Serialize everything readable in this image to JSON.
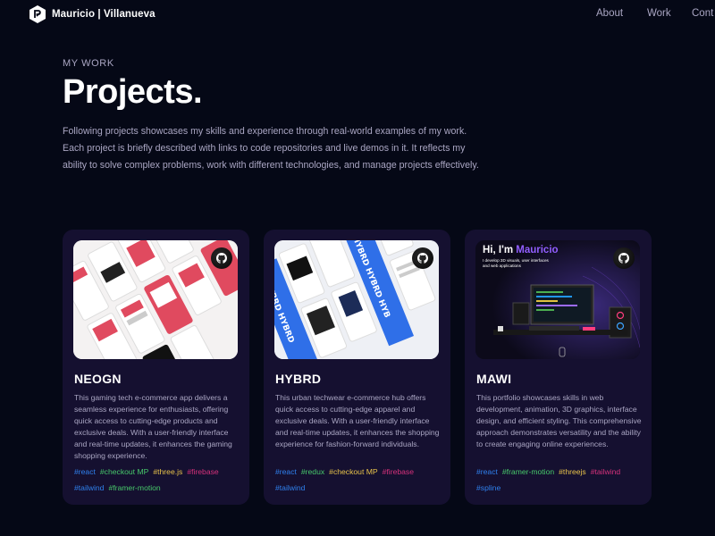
{
  "nav": {
    "brand": "Mauricio | Villanueva",
    "links": [
      "About",
      "Work",
      "Cont"
    ]
  },
  "hero": {
    "eyebrow": "MY WORK",
    "title": "Projects.",
    "intro": "Following projects showcases my skills and experience through real-world examples of my work. Each project is briefly described with links to code repositories and live demos in it. It reflects my ability to solve complex problems, work with different technologies, and manage projects effectively."
  },
  "projects": [
    {
      "name": "NEOGN",
      "description": "This gaming tech e-commerce app delivers a seamless experience for enthusiasts, offering quick access to cutting-edge products and exclusive deals. With a user-friendly interface and real-time updates, it enhances the gaming shopping experience.",
      "tags": [
        {
          "label": "#react",
          "color": "#2f80ed"
        },
        {
          "label": "#checkout MP",
          "color": "#47c96a"
        },
        {
          "label": "#three.js",
          "color": "#e8c34a"
        },
        {
          "label": "#firebase",
          "color": "#d6317b"
        },
        {
          "label": "#tailwind",
          "color": "#2f80ed"
        },
        {
          "label": "#framer-motion",
          "color": "#47c96a"
        }
      ]
    },
    {
      "name": "HYBRD",
      "description": "This urban techwear e-commerce hub offers quick access to cutting-edge apparel and exclusive deals. With a user-friendly interface and real-time updates, it enhances the shopping experience for fashion-forward individuals.",
      "tags": [
        {
          "label": "#react",
          "color": "#2f80ed"
        },
        {
          "label": "#redux",
          "color": "#47c96a"
        },
        {
          "label": "#checkout MP",
          "color": "#e8c34a"
        },
        {
          "label": "#firebase",
          "color": "#d6317b"
        },
        {
          "label": "#tailwind",
          "color": "#2f80ed"
        }
      ]
    },
    {
      "name": "MAWI",
      "description": "This portfolio showcases skills in web development, animation, 3D graphics, interface design, and efficient styling. This comprehensive approach demonstrates versatility and the ability to create engaging online experiences.",
      "tags": [
        {
          "label": "#react",
          "color": "#2f80ed"
        },
        {
          "label": "#framer-motion",
          "color": "#47c96a"
        },
        {
          "label": "#threejs",
          "color": "#e8c34a"
        },
        {
          "label": "#tailwind",
          "color": "#d6317b"
        },
        {
          "label": "#spline",
          "color": "#2f80ed"
        }
      ],
      "preview": {
        "greeting": "Hi, I'm ",
        "greeting_name": "Mauricio",
        "subtitle": "I develop 3D visuals, user interfaces and web applications"
      }
    }
  ],
  "theme": {
    "background": "#050816",
    "card": "#151030",
    "secondary_text": "#aaa6c3",
    "accent": "#915eff"
  }
}
